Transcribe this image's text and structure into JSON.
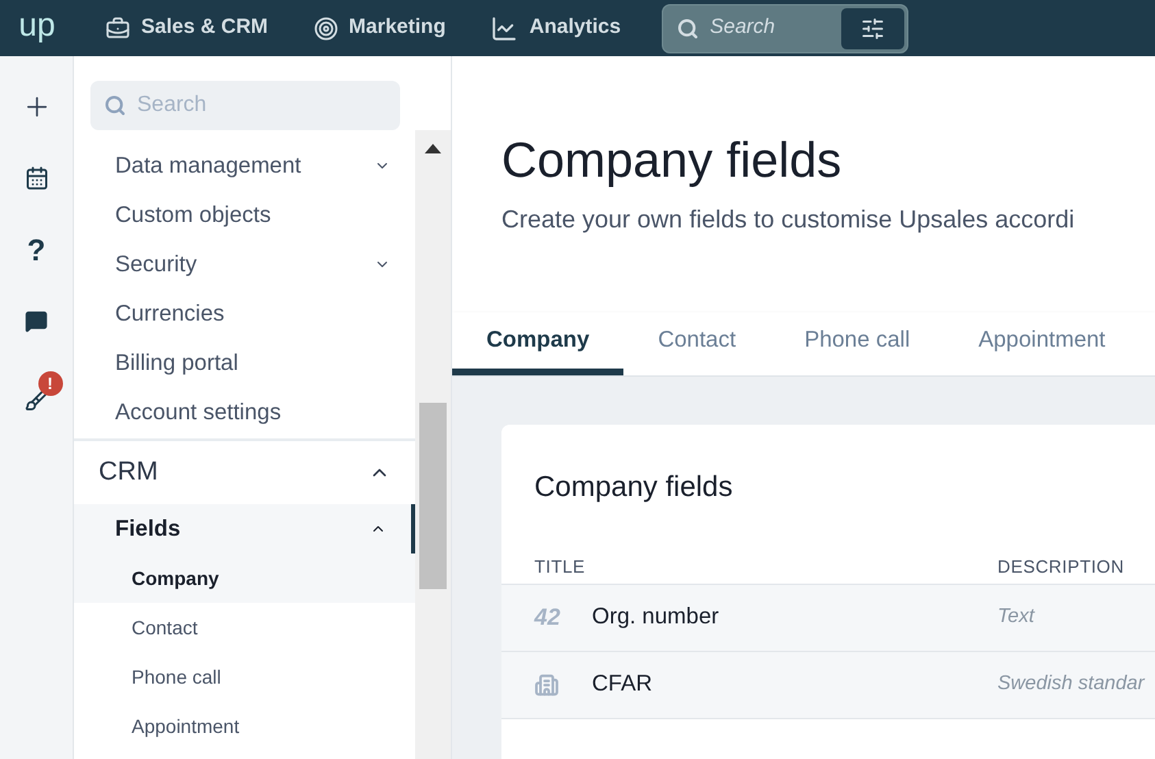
{
  "topbar": {
    "logo": "up",
    "nav": [
      {
        "kind": "sales",
        "label": "Sales & CRM"
      },
      {
        "kind": "marketing",
        "label": "Marketing"
      },
      {
        "kind": "analytics",
        "label": "Analytics"
      }
    ],
    "search": {
      "placeholder": "Search"
    }
  },
  "rail": [
    {
      "kind": "add"
    },
    {
      "kind": "calendar"
    },
    {
      "kind": "help",
      "label": "?"
    },
    {
      "kind": "chat"
    },
    {
      "kind": "broom",
      "badge": "!"
    }
  ],
  "sidebar": {
    "search": {
      "placeholder": "Search"
    },
    "items": [
      {
        "label": "Data management",
        "kind": "collapsible",
        "expanded": false
      },
      {
        "label": "Custom objects",
        "kind": "link"
      },
      {
        "label": "Security",
        "kind": "collapsible",
        "expanded": false
      },
      {
        "label": "Currencies",
        "kind": "link"
      },
      {
        "label": "Billing portal",
        "kind": "link"
      },
      {
        "label": "Account settings",
        "kind": "link"
      }
    ],
    "section": {
      "label": "CRM",
      "expanded": true,
      "items": [
        {
          "label": "Fields",
          "expanded": true,
          "children": [
            {
              "label": "Company",
              "selected": true
            },
            {
              "label": "Contact",
              "selected": false
            },
            {
              "label": "Phone call",
              "selected": false
            },
            {
              "label": "Appointment",
              "selected": false
            }
          ]
        }
      ]
    }
  },
  "page": {
    "title": "Company fields",
    "subtitle": "Create your own fields to customise Upsales accordi",
    "tabs": [
      {
        "label": "Company",
        "selected": true
      },
      {
        "label": "Contact",
        "selected": false
      },
      {
        "label": "Phone call",
        "selected": false
      },
      {
        "label": "Appointment",
        "selected": false
      }
    ],
    "card": {
      "title": "Company fields",
      "columns": [
        "TITLE",
        "DESCRIPTION"
      ],
      "rows": [
        {
          "kind": "number",
          "icon_text": "42",
          "title": "Org. number",
          "description": "Text"
        },
        {
          "kind": "building",
          "title": "CFAR",
          "description": "Swedish standar"
        }
      ]
    }
  }
}
